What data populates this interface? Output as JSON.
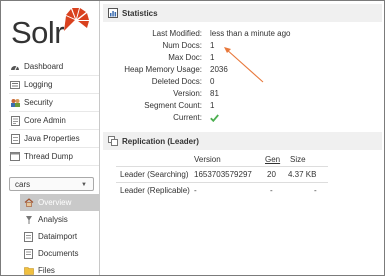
{
  "app": {
    "logo_text": "Solr",
    "brand_color": "#d9411e"
  },
  "sidebar": {
    "items": [
      {
        "label": "Dashboard",
        "icon": "dashboard-icon"
      },
      {
        "label": "Logging",
        "icon": "logging-icon"
      },
      {
        "label": "Security",
        "icon": "security-icon"
      },
      {
        "label": "Core Admin",
        "icon": "core-admin-icon"
      },
      {
        "label": "Java Properties",
        "icon": "java-properties-icon"
      },
      {
        "label": "Thread Dump",
        "icon": "thread-dump-icon"
      }
    ],
    "core_selector": {
      "value": "cars"
    },
    "core_items": [
      {
        "label": "Overview",
        "icon": "home-icon",
        "active": true
      },
      {
        "label": "Analysis",
        "icon": "analysis-icon"
      },
      {
        "label": "Dataimport",
        "icon": "dataimport-icon"
      },
      {
        "label": "Documents",
        "icon": "documents-icon"
      },
      {
        "label": "Files",
        "icon": "files-icon"
      }
    ]
  },
  "statistics": {
    "title": "Statistics",
    "rows": [
      {
        "label": "Last Modified:",
        "value": "less than a minute ago"
      },
      {
        "label": "Num Docs:",
        "value": "1"
      },
      {
        "label": "Max Doc:",
        "value": "1"
      },
      {
        "label": "Heap Memory Usage:",
        "value": "2036"
      },
      {
        "label": "Deleted Docs:",
        "value": "0"
      },
      {
        "label": "Version:",
        "value": "81"
      },
      {
        "label": "Segment Count:",
        "value": "1"
      },
      {
        "label": "Current:",
        "value": ""
      }
    ],
    "current_status_color": "#4caf50",
    "annotation_color": "#e8783b"
  },
  "replication": {
    "title": "Replication (Leader)",
    "columns": {
      "version": "Version",
      "gen": "Gen",
      "size": "Size"
    },
    "rows": [
      {
        "label": "Leader (Searching)",
        "version": "1653703579297",
        "gen": "20",
        "size": "4.37 KB"
      },
      {
        "label": "Leader (Replicable)",
        "version": "-",
        "gen": "-",
        "size": "-"
      }
    ]
  }
}
